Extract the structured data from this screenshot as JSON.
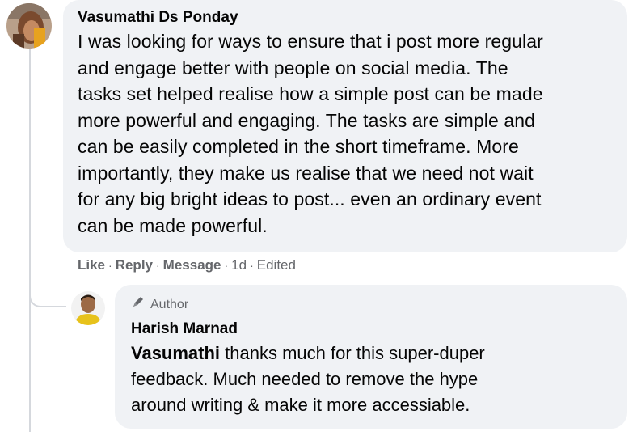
{
  "main_comment": {
    "author": "Vasumathi Ds Ponday",
    "lines": [
      "I was looking for ways to ensure that i post more regular",
      "and engage better with people on social media. The",
      "tasks set helped realise how a simple post can be made",
      "more powerful and engaging. The tasks are simple and",
      "can be easily completed in the short timeframe. More",
      "importantly, they make us realise that we need not wait",
      "for any big bright ideas to post... even an ordinary event",
      "can be made powerful."
    ]
  },
  "actions": {
    "like": "Like",
    "reply": "Reply",
    "message": "Message",
    "time": "1d",
    "edited": "Edited",
    "separator": "·"
  },
  "reply_comment": {
    "badge": "Author",
    "author": "Harish Marnad",
    "mention": "Vasumathi",
    "lines": [
      " thanks much for this super-duper",
      "feedback. Much needed to remove the hype",
      "around writing & make it more accessiable."
    ]
  },
  "icons": {
    "badge_icon": "pen-icon"
  },
  "colors": {
    "bubble": "#f0f2f5",
    "text": "#050505",
    "secondary": "#65676b",
    "thread": "#d5d8dd"
  }
}
